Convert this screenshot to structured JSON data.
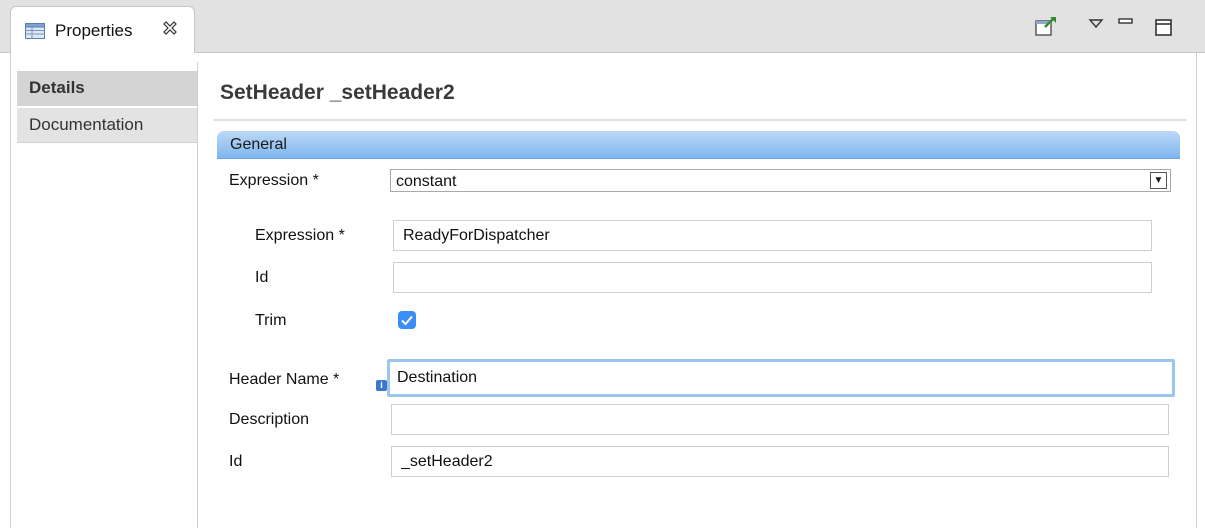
{
  "view": {
    "tab_title": "Properties",
    "icons": {
      "tab": "properties-table-icon",
      "close": "close-icon",
      "toolbar": [
        "pin-editor-icon",
        "view-menu-icon",
        "minimize-icon",
        "maximize-icon"
      ]
    }
  },
  "sidebar": {
    "tabs": [
      {
        "label": "Details",
        "selected": true
      },
      {
        "label": "Documentation",
        "selected": false
      }
    ]
  },
  "main": {
    "title": "SetHeader _setHeader2",
    "section": "General",
    "expression_type": {
      "label": "Expression *",
      "selected": "constant"
    },
    "sub": {
      "expression": {
        "label": "Expression *",
        "value": "ReadyForDispatcher"
      },
      "id": {
        "label": "Id",
        "value": ""
      },
      "trim": {
        "label": "Trim",
        "checked": true
      }
    },
    "header_name": {
      "label": "Header Name *",
      "value": "Destination"
    },
    "description": {
      "label": "Description",
      "value": ""
    },
    "id": {
      "label": "Id",
      "value": "_setHeader2"
    }
  },
  "colors": {
    "group_header_top": "#bcd9f6",
    "group_header_bottom": "#7fb5ee",
    "checkbox": "#3b8ef5",
    "focus_ring": "#9cc5ef"
  }
}
